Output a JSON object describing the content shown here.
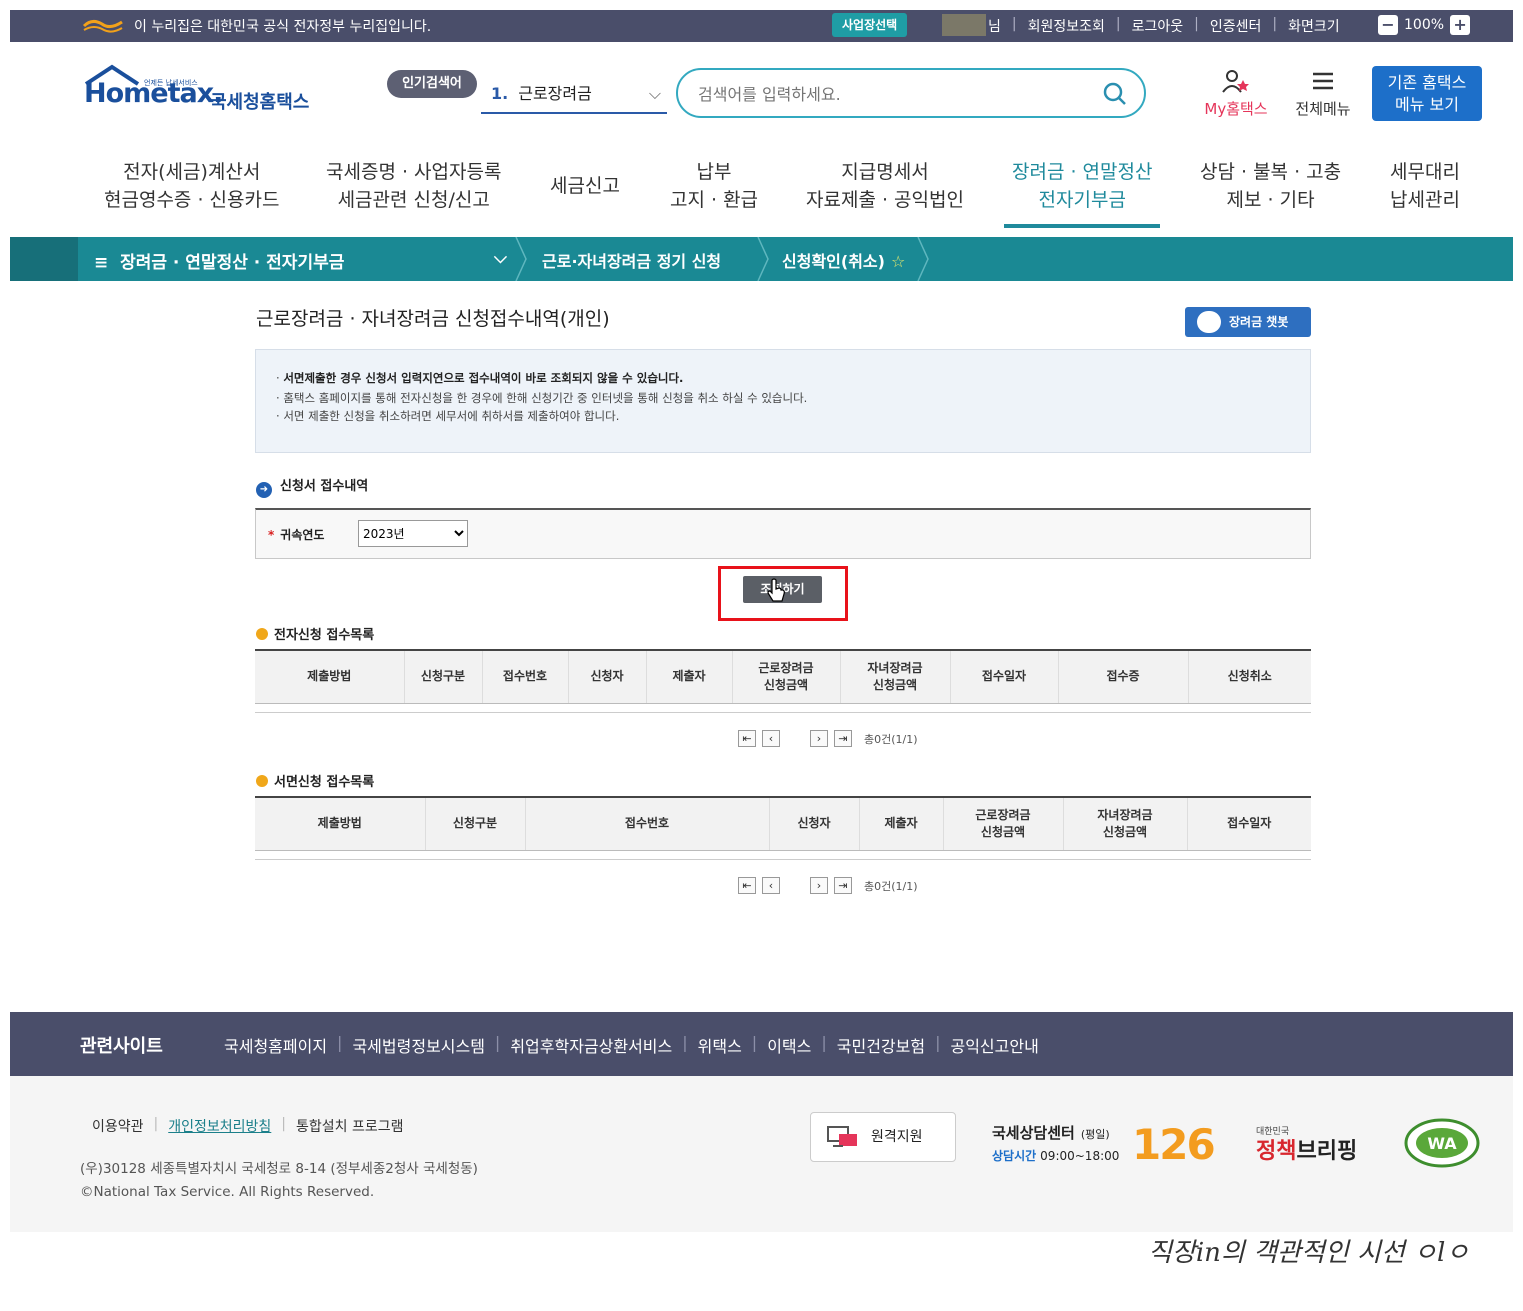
{
  "govbar": {
    "notice": "이 누리집은 대한민국 공식 전자정부 누리집입니다.",
    "biz_select": "사업장선택",
    "user_suffix": "님",
    "links": [
      "회원정보조회",
      "로그아웃",
      "인증센터",
      "화면크기"
    ],
    "zoom": "100%"
  },
  "header": {
    "logo_word": "Hometax.",
    "logo_kr": "국세청홈택스",
    "logo_tiny": "언제든 납세서비스",
    "popular_label": "인기검색어",
    "popular_rank": "1.",
    "popular_term": "근로장려금",
    "search_placeholder": "검색어를 입력하세요.",
    "my_hometax": "My홈택스",
    "all_menu": "전체메뉴",
    "old_menu_line1": "기존 홈택스",
    "old_menu_line2": "메뉴 보기"
  },
  "mainnav": [
    {
      "l1": "전자(세금)계산서",
      "l2": "현금영수증 · 신용카드"
    },
    {
      "l1": "국세증명 · 사업자등록",
      "l2": "세금관련 신청/신고"
    },
    {
      "l1": "세금신고",
      "l2": ""
    },
    {
      "l1": "납부",
      "l2": "고지 · 환급"
    },
    {
      "l1": "지급명세서",
      "l2": "자료제출 · 공익법인"
    },
    {
      "l1": "장려금 · 연말정산",
      "l2": "전자기부금"
    },
    {
      "l1": "상담 · 불복 · 고충",
      "l2": "제보 · 기타"
    },
    {
      "l1": "세무대리",
      "l2": "납세관리"
    }
  ],
  "breadcrumb": {
    "menu_icon": "≡",
    "c1": "장려금 · 연말정산 · 전자기부금",
    "c2": "근로·자녀장려금 정기 신청",
    "c3": "신청확인(취소)"
  },
  "page": {
    "title": "근로장려금 · 자녀장려금 신청접수내역(개인)",
    "chatbot": "장려금 챗봇",
    "notices": [
      "서면제출한 경우 신청서 입력지연으로 접수내역이 바로 조회되지 않을 수 있습니다.",
      "홈택스 홈페이지를 통해 전자신청을 한 경우에 한해 신청기간 중 인터넷을 통해 신청을 취소 하실 수 있습니다.",
      "서면 제출한 신청을 취소하려면 세무서에 취하서를 제출하여야 합니다."
    ],
    "section_title": "신청서 접수내역",
    "year_label": "귀속연도",
    "year_value": "2023년",
    "query_button": "조회하기",
    "electronic_title": "전자신청 접수목록",
    "electronic_headers": [
      "제출방법",
      "신청구분",
      "접수번호",
      "신청자",
      "제출자",
      "근로장려금\n신청금액",
      "자녀장려금\n신청금액",
      "접수일자",
      "접수증",
      "신청취소"
    ],
    "paper_title": "서면신청 접수목록",
    "paper_headers": [
      "제출방법",
      "신청구분",
      "접수번호",
      "신청자",
      "제출자",
      "근로장려금\n신청금액",
      "자녀장려금\n신청금액",
      "접수일자"
    ],
    "pager_total": "총0건(1/1)"
  },
  "footer": {
    "related_title": "관련사이트",
    "related_links": [
      "국세청홈페이지",
      "국세법령정보시스템",
      "취업후학자금상환서비스",
      "위택스",
      "이택스",
      "국민건강보험",
      "공익신고안내"
    ],
    "terms": "이용약관",
    "privacy": "개인정보처리방침",
    "install": "통합설치 프로그램",
    "address": "(우)30128 세종특별자치시 국세청로 8-14 (정부세종2청사 국세청동)",
    "copyright": "©National Tax Service. All Rights Reserved.",
    "remote": "원격지원",
    "call_title": "국세상담센터",
    "call_sub": "(평일)",
    "call_hours_label": "상담시간",
    "call_hours": "09:00~18:00",
    "call_number_a": "1",
    "call_number_b": "26",
    "policy_small": "대한민국",
    "policy_a": "정책",
    "policy_b": "브리핑",
    "wa_mark": "WA"
  },
  "signature": "직장in의 객관적인 시선 ㅇlㅇ"
}
